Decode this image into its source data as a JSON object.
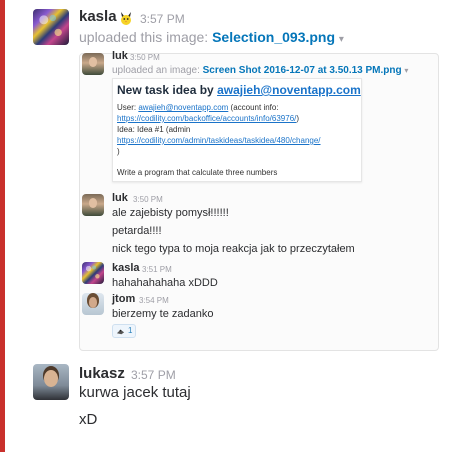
{
  "messages": {
    "top": {
      "author": "kasla",
      "time": "3:57 PM",
      "uploaded_text": "uploaded this image:",
      "file_name": "Selection_093.png",
      "caret": "▾"
    },
    "last": {
      "author": "lukasz",
      "time": "3:57 PM",
      "lines": [
        "kurwa jacek tutaj",
        "xD"
      ]
    }
  },
  "screenshot": {
    "header": {
      "author": "luk",
      "time": "3:50 PM",
      "uploaded_text": "uploaded an image:",
      "file_name": "Screen Shot 2016-12-07 at 3.50.13 PM.png",
      "caret": "▾"
    },
    "embedded": {
      "title_prefix": "New task idea by",
      "title_email": "awajieh@noventapp.com",
      "line1_prefix": "User:",
      "line1_email": "awajieh@noventapp.com",
      "line1_suffix": "(account info:",
      "line2_link": "https://codility.com/backoffice/accounts/info/63976/",
      "line2_suffix": ")",
      "line3": "Idea: Idea #1 (admin",
      "line4_link": "https://codility.com/admin/taskideas/taskidea/480/change/",
      "line5": ")",
      "line6": "Write a program that calculate three numbers"
    },
    "thread": [
      {
        "author": "luk",
        "time": "3:50 PM",
        "lines": [
          "ale zajebisty pomysł!!!!!!",
          "petarda!!!!",
          "nick tego typa to moja reakcja jak to przeczytałem"
        ]
      },
      {
        "author": "kasla",
        "time": "3:51 PM",
        "lines": [
          "hahahahahaha xDDD"
        ]
      },
      {
        "author": "jtom",
        "time": "3:54 PM",
        "lines": [
          "bierzemy te zadanko"
        ]
      }
    ],
    "reaction": {
      "count": "1",
      "icon": "bird-emoji-icon"
    }
  },
  "colors": {
    "accent_rule": "#c9302c",
    "link": "#0576b9",
    "muted": "#9e9ea6"
  }
}
